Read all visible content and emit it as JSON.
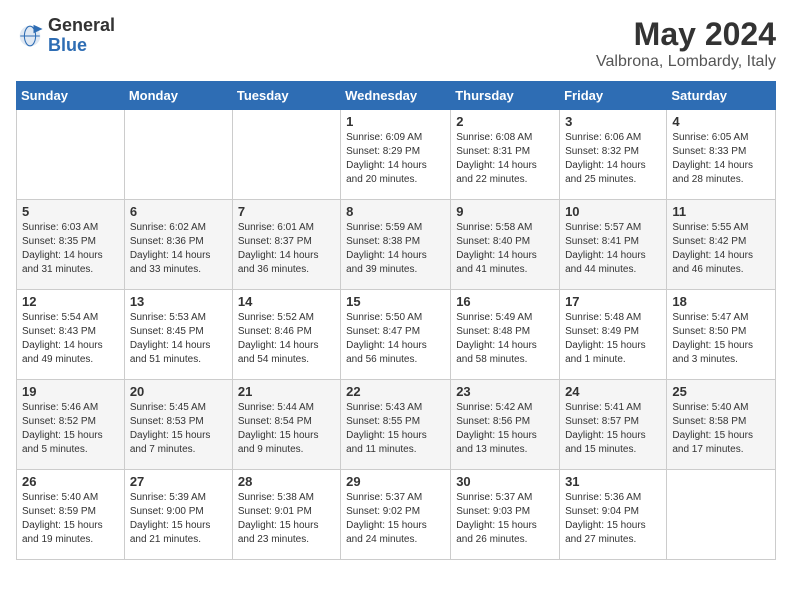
{
  "header": {
    "logo_general": "General",
    "logo_blue": "Blue",
    "month_title": "May 2024",
    "location": "Valbrona, Lombardy, Italy"
  },
  "weekdays": [
    "Sunday",
    "Monday",
    "Tuesday",
    "Wednesday",
    "Thursday",
    "Friday",
    "Saturday"
  ],
  "weeks": [
    [
      {
        "day": "",
        "info": ""
      },
      {
        "day": "",
        "info": ""
      },
      {
        "day": "",
        "info": ""
      },
      {
        "day": "1",
        "info": "Sunrise: 6:09 AM\nSunset: 8:29 PM\nDaylight: 14 hours\nand 20 minutes."
      },
      {
        "day": "2",
        "info": "Sunrise: 6:08 AM\nSunset: 8:31 PM\nDaylight: 14 hours\nand 22 minutes."
      },
      {
        "day": "3",
        "info": "Sunrise: 6:06 AM\nSunset: 8:32 PM\nDaylight: 14 hours\nand 25 minutes."
      },
      {
        "day": "4",
        "info": "Sunrise: 6:05 AM\nSunset: 8:33 PM\nDaylight: 14 hours\nand 28 minutes."
      }
    ],
    [
      {
        "day": "5",
        "info": "Sunrise: 6:03 AM\nSunset: 8:35 PM\nDaylight: 14 hours\nand 31 minutes."
      },
      {
        "day": "6",
        "info": "Sunrise: 6:02 AM\nSunset: 8:36 PM\nDaylight: 14 hours\nand 33 minutes."
      },
      {
        "day": "7",
        "info": "Sunrise: 6:01 AM\nSunset: 8:37 PM\nDaylight: 14 hours\nand 36 minutes."
      },
      {
        "day": "8",
        "info": "Sunrise: 5:59 AM\nSunset: 8:38 PM\nDaylight: 14 hours\nand 39 minutes."
      },
      {
        "day": "9",
        "info": "Sunrise: 5:58 AM\nSunset: 8:40 PM\nDaylight: 14 hours\nand 41 minutes."
      },
      {
        "day": "10",
        "info": "Sunrise: 5:57 AM\nSunset: 8:41 PM\nDaylight: 14 hours\nand 44 minutes."
      },
      {
        "day": "11",
        "info": "Sunrise: 5:55 AM\nSunset: 8:42 PM\nDaylight: 14 hours\nand 46 minutes."
      }
    ],
    [
      {
        "day": "12",
        "info": "Sunrise: 5:54 AM\nSunset: 8:43 PM\nDaylight: 14 hours\nand 49 minutes."
      },
      {
        "day": "13",
        "info": "Sunrise: 5:53 AM\nSunset: 8:45 PM\nDaylight: 14 hours\nand 51 minutes."
      },
      {
        "day": "14",
        "info": "Sunrise: 5:52 AM\nSunset: 8:46 PM\nDaylight: 14 hours\nand 54 minutes."
      },
      {
        "day": "15",
        "info": "Sunrise: 5:50 AM\nSunset: 8:47 PM\nDaylight: 14 hours\nand 56 minutes."
      },
      {
        "day": "16",
        "info": "Sunrise: 5:49 AM\nSunset: 8:48 PM\nDaylight: 14 hours\nand 58 minutes."
      },
      {
        "day": "17",
        "info": "Sunrise: 5:48 AM\nSunset: 8:49 PM\nDaylight: 15 hours\nand 1 minute."
      },
      {
        "day": "18",
        "info": "Sunrise: 5:47 AM\nSunset: 8:50 PM\nDaylight: 15 hours\nand 3 minutes."
      }
    ],
    [
      {
        "day": "19",
        "info": "Sunrise: 5:46 AM\nSunset: 8:52 PM\nDaylight: 15 hours\nand 5 minutes."
      },
      {
        "day": "20",
        "info": "Sunrise: 5:45 AM\nSunset: 8:53 PM\nDaylight: 15 hours\nand 7 minutes."
      },
      {
        "day": "21",
        "info": "Sunrise: 5:44 AM\nSunset: 8:54 PM\nDaylight: 15 hours\nand 9 minutes."
      },
      {
        "day": "22",
        "info": "Sunrise: 5:43 AM\nSunset: 8:55 PM\nDaylight: 15 hours\nand 11 minutes."
      },
      {
        "day": "23",
        "info": "Sunrise: 5:42 AM\nSunset: 8:56 PM\nDaylight: 15 hours\nand 13 minutes."
      },
      {
        "day": "24",
        "info": "Sunrise: 5:41 AM\nSunset: 8:57 PM\nDaylight: 15 hours\nand 15 minutes."
      },
      {
        "day": "25",
        "info": "Sunrise: 5:40 AM\nSunset: 8:58 PM\nDaylight: 15 hours\nand 17 minutes."
      }
    ],
    [
      {
        "day": "26",
        "info": "Sunrise: 5:40 AM\nSunset: 8:59 PM\nDaylight: 15 hours\nand 19 minutes."
      },
      {
        "day": "27",
        "info": "Sunrise: 5:39 AM\nSunset: 9:00 PM\nDaylight: 15 hours\nand 21 minutes."
      },
      {
        "day": "28",
        "info": "Sunrise: 5:38 AM\nSunset: 9:01 PM\nDaylight: 15 hours\nand 23 minutes."
      },
      {
        "day": "29",
        "info": "Sunrise: 5:37 AM\nSunset: 9:02 PM\nDaylight: 15 hours\nand 24 minutes."
      },
      {
        "day": "30",
        "info": "Sunrise: 5:37 AM\nSunset: 9:03 PM\nDaylight: 15 hours\nand 26 minutes."
      },
      {
        "day": "31",
        "info": "Sunrise: 5:36 AM\nSunset: 9:04 PM\nDaylight: 15 hours\nand 27 minutes."
      },
      {
        "day": "",
        "info": ""
      }
    ]
  ]
}
